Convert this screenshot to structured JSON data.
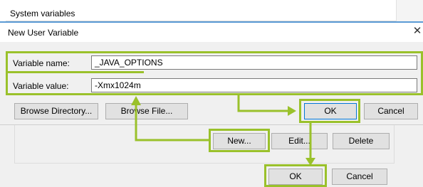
{
  "background_window": {
    "section_label": "System variables",
    "buttons": {
      "new": "New...",
      "edit": "Edit...",
      "delete": "Delete",
      "ok": "OK",
      "cancel": "Cancel"
    }
  },
  "dialog": {
    "title": "New User Variable",
    "close_glyph": "✕",
    "variable_name_label": "Variable name:",
    "variable_name_value": "_JAVA_OPTIONS",
    "variable_value_label": "Variable value:",
    "variable_value_value": "-Xmx1024m",
    "buttons": {
      "browse_directory": "Browse Directory...",
      "browse_file": "Browse File...",
      "ok": "OK",
      "cancel": "Cancel"
    }
  },
  "annotation": {
    "highlight_color": "#9ac12b",
    "dialog_border_color": "#5b9bd5"
  },
  "icons": {
    "close": "close-icon",
    "arrows": "arrow-icon"
  }
}
